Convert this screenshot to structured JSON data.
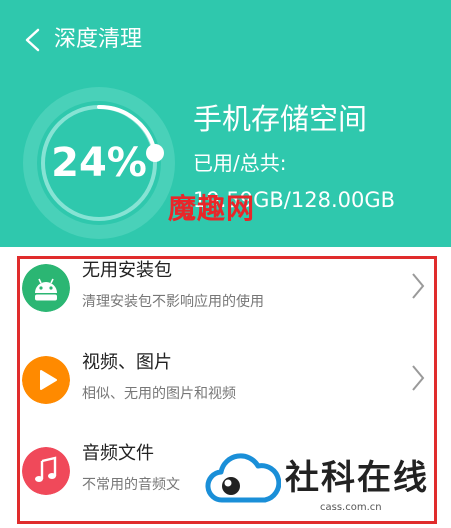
{
  "header": {
    "title": "深度清理",
    "gauge_percent": "24%",
    "storage_title": "手机存储空间",
    "used_label": "已用/总共:",
    "used_value": "19.59GB/128.00GB",
    "bg_color": "#2fc8ad"
  },
  "items": [
    {
      "title": "无用安装包",
      "subtitle": "清理安装包不影响应用的使用",
      "icon": "android-icon",
      "color": "#2bb673"
    },
    {
      "title": "视频、图片",
      "subtitle": "相似、无用的图片和视频",
      "icon": "play-icon",
      "color": "#ff8a00"
    },
    {
      "title": "音频文件",
      "subtitle": "不常用的音频文",
      "icon": "music-note-icon",
      "color": "#f0495a"
    }
  ],
  "watermarks": {
    "red_text": "魔趣网",
    "brand_text": "社科在线",
    "url": "cass.com.cn"
  }
}
